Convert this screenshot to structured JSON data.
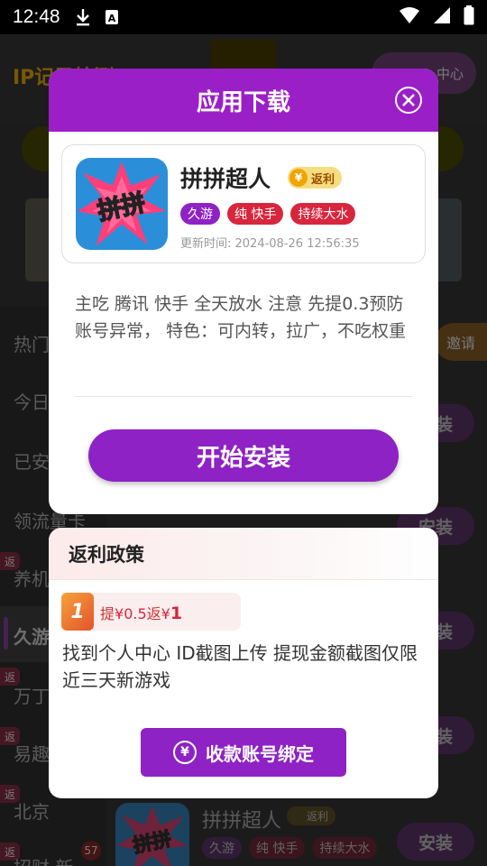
{
  "status_bar": {
    "time": "12:48"
  },
  "background": {
    "title": "IP记录检测",
    "pill_label": "中心",
    "sidebar": {
      "items": [
        "热门",
        "今日",
        "已安",
        "领流量卡",
        "养机",
        "久游",
        "万丁",
        "易趣",
        "北京",
        "招财 新"
      ],
      "tag_label": "返",
      "badge_count": "57"
    },
    "invite_label": "邀请",
    "install_label": "安装",
    "last_item": {
      "name": "拼拼超人",
      "rebate": "返利",
      "tags": [
        "久游",
        "纯 快手",
        "持续大水"
      ],
      "install": "安装"
    }
  },
  "modal": {
    "title": "应用下载",
    "app": {
      "name": "拼拼超人",
      "icon_text": "拼拼",
      "rebate_label": "返利",
      "tags": [
        "久游",
        "纯 快手",
        "持续大水"
      ],
      "update_time": "更新时间: 2024-08-26 12:56:35"
    },
    "description": "主吃 腾讯 快手 全天放水  注意 先提0.3预防账号异常， 特色：可内转，拉广，不吃权重",
    "install_button": "开始安装"
  },
  "policy": {
    "title": "返利政策",
    "rule": {
      "number": "1",
      "withdraw_label": "提",
      "withdraw_amount": "¥0.5",
      "rebate_label": "返",
      "rebate_currency": "¥",
      "rebate_amount": "1"
    },
    "description": "找到个人中心 ID截图上传 提现金额截图仅限近三天新游戏",
    "bind_button": "收款账号绑定"
  },
  "colors": {
    "primary": "#9b1fc7",
    "accent_red": "#d7263d",
    "gold": "#f0a500"
  }
}
